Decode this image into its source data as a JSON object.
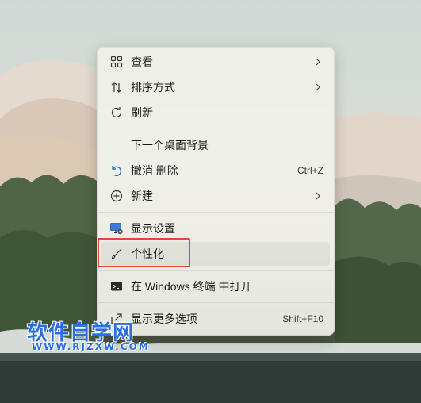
{
  "menu": {
    "items": [
      {
        "label": "查看",
        "icon": "grid-icon",
        "submenu": true
      },
      {
        "label": "排序方式",
        "icon": "sort-arrows-icon",
        "submenu": true
      },
      {
        "label": "刷新",
        "icon": "refresh-icon",
        "submenu": false
      },
      {
        "label": "下一个桌面背景",
        "icon": "",
        "submenu": false
      },
      {
        "label": "撤消 删除",
        "icon": "undo-icon",
        "shortcut": "Ctrl+Z",
        "submenu": false
      },
      {
        "label": "新建",
        "icon": "plus-circle-icon",
        "submenu": true
      },
      {
        "label": "显示设置",
        "icon": "display-settings-icon",
        "submenu": false
      },
      {
        "label": "个性化",
        "icon": "brush-icon",
        "submenu": false,
        "highlighted": true
      },
      {
        "label": "在 Windows 终端 中打开",
        "icon": "terminal-icon",
        "submenu": false
      },
      {
        "label": "显示更多选项",
        "icon": "more-options-icon",
        "shortcut": "Shift+F10",
        "submenu": false
      }
    ]
  },
  "watermark": {
    "title": "软件自学网",
    "url": "WWW.RJZXW.COM"
  },
  "colors": {
    "highlight_box": "#e8413e",
    "accent": "#2a6fe0"
  }
}
